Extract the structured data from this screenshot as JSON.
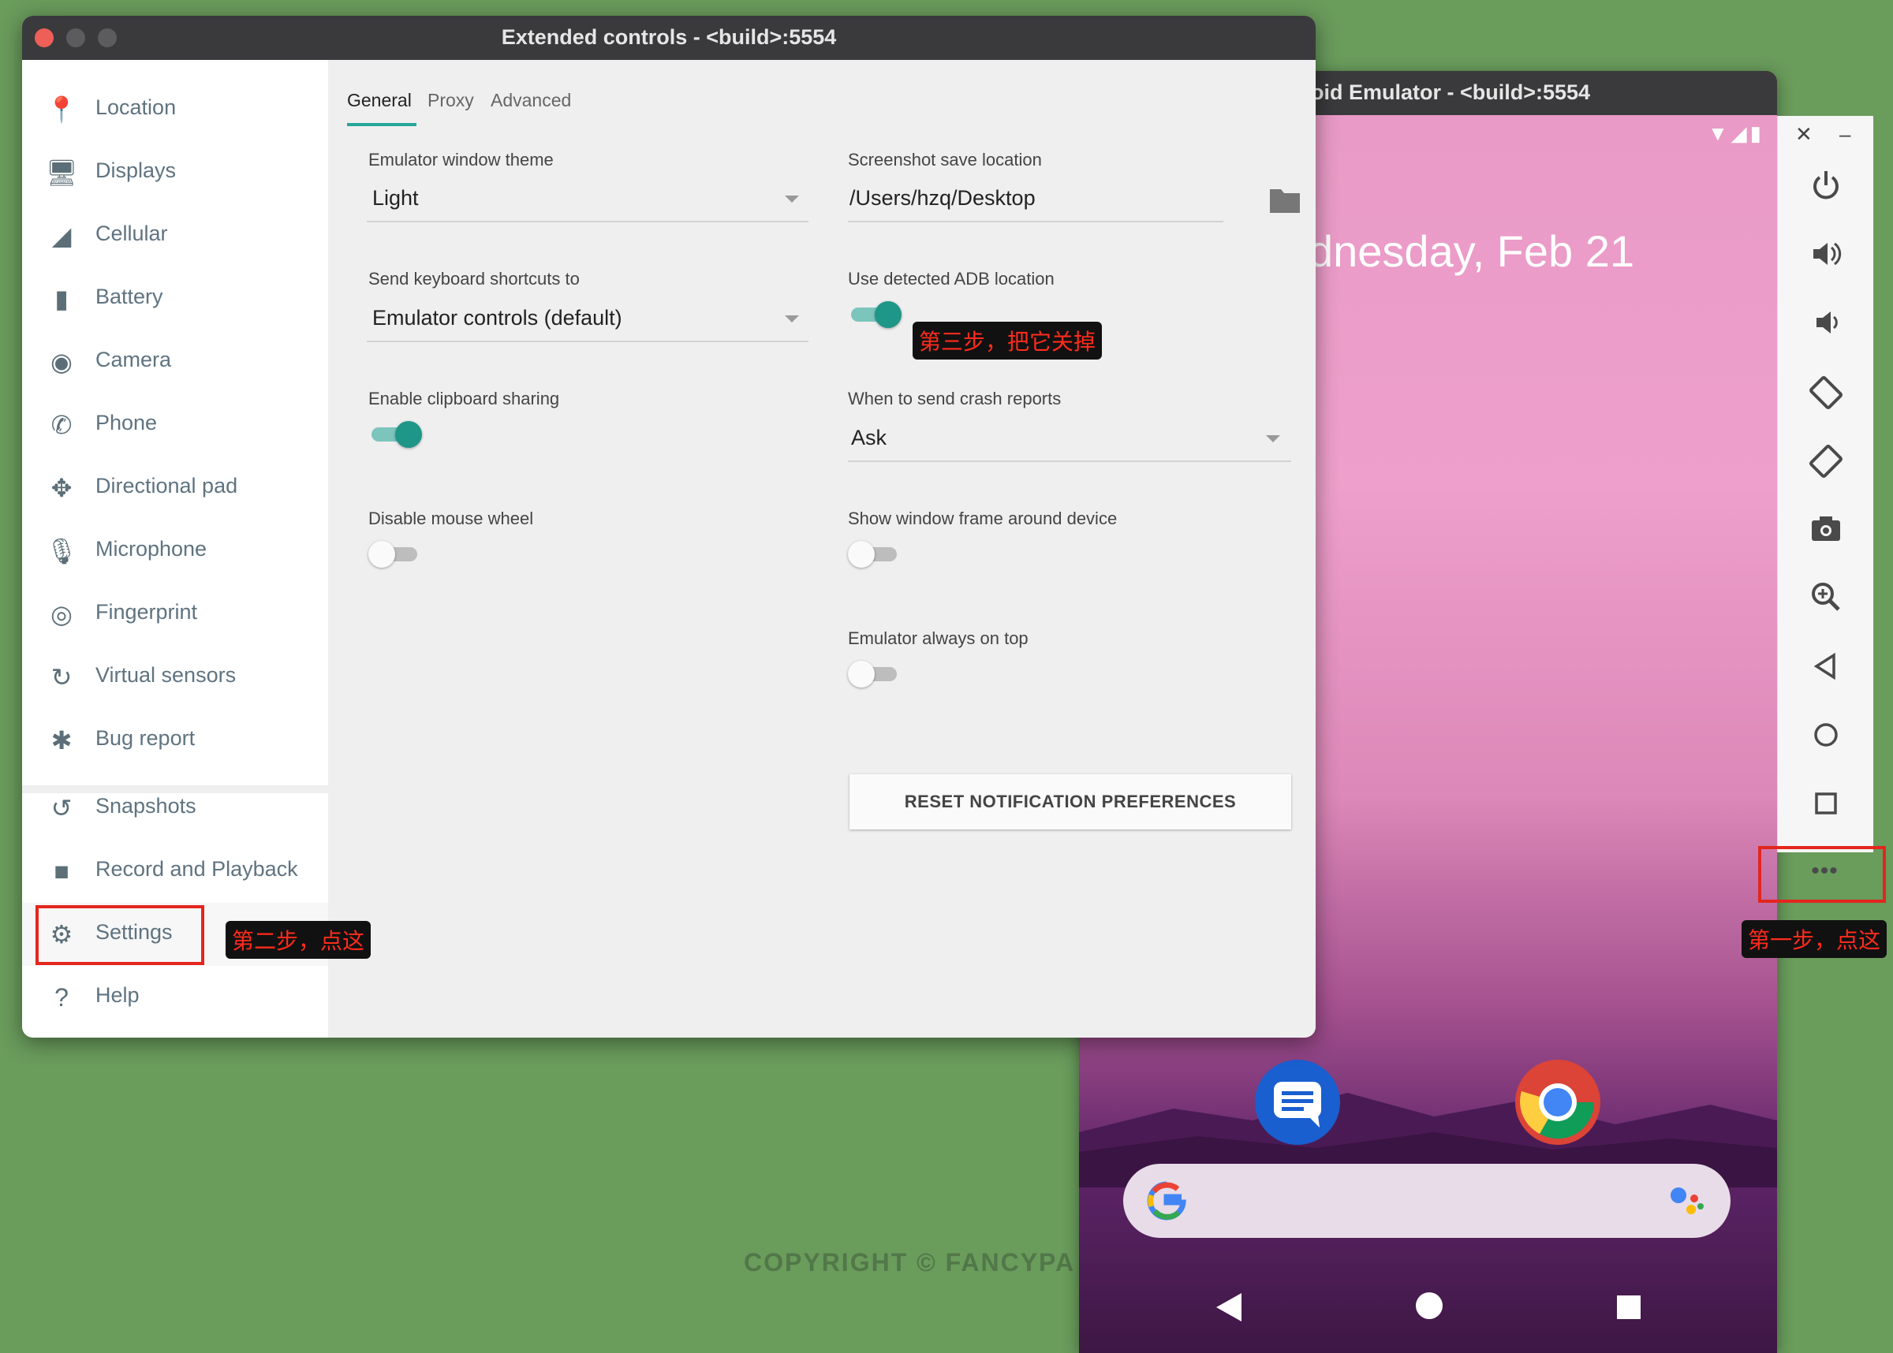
{
  "watermark": "COPYRIGHT © FANCYPA",
  "emulator": {
    "title": "oid Emulator - <build>:5554",
    "status_icons": "▼◢▮",
    "date": "dnesday, Feb 21",
    "toolbar": {
      "close": "✕",
      "minimize": "–",
      "more": "•••"
    },
    "annotation_step1": "第一步，点这"
  },
  "extended": {
    "title": "Extended controls - <build>:5554",
    "sidebar": [
      {
        "label": "Location",
        "icon": "📍"
      },
      {
        "label": "Displays",
        "icon": "🖥"
      },
      {
        "label": "Cellular",
        "icon": "◢"
      },
      {
        "label": "Battery",
        "icon": "▮"
      },
      {
        "label": "Camera",
        "icon": "◉"
      },
      {
        "label": "Phone",
        "icon": "✆"
      },
      {
        "label": "Directional pad",
        "icon": "✥"
      },
      {
        "label": "Microphone",
        "icon": "🎙"
      },
      {
        "label": "Fingerprint",
        "icon": "◎"
      },
      {
        "label": "Virtual sensors",
        "icon": "↻"
      },
      {
        "label": "Bug report",
        "icon": "✱"
      },
      {
        "label": "Snapshots",
        "icon": "↺"
      },
      {
        "label": "Record and Playback",
        "icon": "■"
      },
      {
        "label": "Settings",
        "icon": "⚙"
      },
      {
        "label": "Help",
        "icon": "?"
      }
    ],
    "annotation_step2": "第二步，点这",
    "tabs": [
      "General",
      "Proxy",
      "Advanced"
    ],
    "settings": {
      "theme_label": "Emulator window theme",
      "theme_value": "Light",
      "shortcuts_label": "Send keyboard shortcuts to",
      "shortcuts_value": "Emulator controls (default)",
      "clipboard_label": "Enable clipboard sharing",
      "mousewheel_label": "Disable mouse wheel",
      "screenshot_label": "Screenshot save location",
      "screenshot_value": "/Users/hzq/Desktop",
      "adb_label": "Use detected ADB location",
      "crash_label": "When to send crash reports",
      "crash_value": "Ask",
      "frame_label": "Show window frame around device",
      "ontop_label": "Emulator always on top",
      "reset_button": "RESET NOTIFICATION PREFERENCES"
    },
    "annotation_step3": "第三步，把它关掉"
  }
}
